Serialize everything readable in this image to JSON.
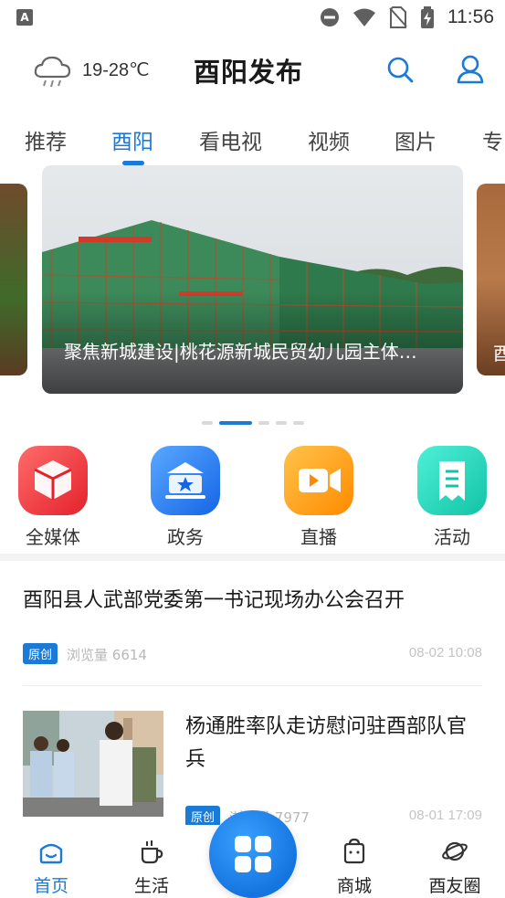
{
  "status_bar": {
    "left_icon": "A",
    "time": "11:56"
  },
  "header": {
    "weather": "19-28℃",
    "title": "酉阳发布"
  },
  "tabs": [
    {
      "label": "推荐"
    },
    {
      "label": "酉阳"
    },
    {
      "label": "看电视"
    },
    {
      "label": "视频"
    },
    {
      "label": "图片"
    },
    {
      "label": "专"
    }
  ],
  "carousel": {
    "caption": "聚焦新城建设|桃花源新城民贸幼儿园主体…",
    "right_card_caption": "酉",
    "active_index": 1,
    "dot_count": 5
  },
  "shortcuts": [
    {
      "label": "全媒体",
      "icon": "cube-icon"
    },
    {
      "label": "政务",
      "icon": "government-icon"
    },
    {
      "label": "直播",
      "icon": "video-camera-icon"
    },
    {
      "label": "活动",
      "icon": "ticket-icon"
    }
  ],
  "news": [
    {
      "title": "酉阳县人武部党委第一书记现场办公会召开",
      "badge": "原创",
      "views_label": "浏览量",
      "views": "6614",
      "date": "08-02 10:08"
    },
    {
      "title": "杨通胜率队走访慰问驻酉部队官兵",
      "badge": "原创",
      "views_label": "浏览量",
      "views": "7977",
      "date": "08-01 17:09"
    }
  ],
  "bottom_nav": [
    {
      "label": "首页",
      "icon": "home-icon"
    },
    {
      "label": "生活",
      "icon": "coffee-cup-icon"
    },
    {
      "label": "",
      "icon": "apps-grid-icon"
    },
    {
      "label": "商城",
      "icon": "shopping-bag-icon"
    },
    {
      "label": "酉友圈",
      "icon": "planet-icon"
    }
  ],
  "colors": {
    "accent": "#1a7ad6",
    "meta_text": "#b8b8b8"
  }
}
